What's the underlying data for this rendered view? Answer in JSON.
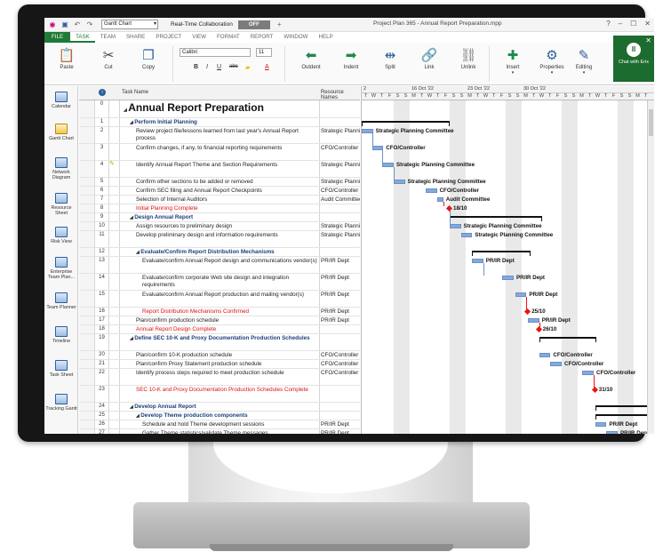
{
  "window": {
    "view_select": "Gantt Chart",
    "collab_label": "Real-Time Collaboration",
    "collab_toggle": "OFF",
    "title": "Project Plan 365 - Annual Report Preparation.mpp",
    "win_help": "?",
    "win_min": "–",
    "win_max": "☐",
    "win_close": "✕"
  },
  "tabs": [
    "FILE",
    "TASK",
    "TEAM",
    "SHARE",
    "PROJECT",
    "VIEW",
    "FORMAT",
    "REPORT",
    "WINDOW",
    "HELP"
  ],
  "ribbon": {
    "paste": "Paste",
    "cut": "Cut",
    "copy": "Copy",
    "font_name": "Calibri",
    "font_size": "11",
    "bold": "B",
    "italic": "I",
    "underline": "U",
    "strike": "abc",
    "outdent": "Outdent",
    "indent": "Indent",
    "split": "Split",
    "link": "Link",
    "unlink": "Unlink",
    "insert": "Insert",
    "properties": "Properties",
    "editing": "Editing",
    "chat": "Chat with Erix"
  },
  "leftnav": [
    "Calendar",
    "Gantt Chart",
    "Network Diagram",
    "Resource Sheet",
    "Risk View",
    "Enterprise Team Plan...",
    "Team Planner",
    "Timeline",
    "Task Sheet",
    "Tracking Gantt"
  ],
  "grid": {
    "header_task": "Task Name",
    "header_res": "Resource Names",
    "header_info": "i",
    "rows": [
      {
        "id": "0",
        "name": "Annual Report Preparation",
        "res": "",
        "type": "title",
        "indent": 0,
        "lines": 2
      },
      {
        "id": "1",
        "name": "Perform Initial Planning",
        "res": "",
        "type": "summary",
        "indent": 1,
        "lines": 1
      },
      {
        "id": "2",
        "name": "Review project file/lessons learned from last year's Annual Report process",
        "res": "Strategic Planning Commi",
        "type": "task",
        "indent": 2,
        "lines": 2
      },
      {
        "id": "3",
        "name": "Confirm changes, if any, to financial reporting requirements",
        "res": "CFO/Controller",
        "type": "task",
        "indent": 2,
        "lines": 2
      },
      {
        "id": "4",
        "name": "Identify Annual Report Theme and Section Requirements",
        "res": "Strategic Planning Commi",
        "type": "task",
        "indent": 2,
        "lines": 2
      },
      {
        "id": "5",
        "name": "Confirm other sections to be added or removed",
        "res": "Strategic Planning Commi",
        "type": "task",
        "indent": 2,
        "lines": 1
      },
      {
        "id": "6",
        "name": "Confirm SEC filing and Annual Report Checkpoints",
        "res": "CFO/Controller",
        "type": "task",
        "indent": 2,
        "lines": 1
      },
      {
        "id": "7",
        "name": "Selection of Internal Auditors",
        "res": "Audit Committee",
        "type": "task",
        "indent": 2,
        "lines": 1
      },
      {
        "id": "8",
        "name": "Initial Planning Complete",
        "res": "",
        "type": "milestone",
        "indent": 2,
        "lines": 1
      },
      {
        "id": "9",
        "name": "Design Annual Report",
        "res": "",
        "type": "summary",
        "indent": 1,
        "lines": 1
      },
      {
        "id": "10",
        "name": "Assign resources to preliminary design",
        "res": "Strategic Planning Commi",
        "type": "task",
        "indent": 2,
        "lines": 1
      },
      {
        "id": "11",
        "name": "Develop preliminary design and information requirements",
        "res": "Strategic Planning Commi",
        "type": "task",
        "indent": 2,
        "lines": 2
      },
      {
        "id": "12",
        "name": "Evaluate/Confirm Report Distribution Mechanisms",
        "res": "",
        "type": "summary",
        "indent": 2,
        "lines": 1
      },
      {
        "id": "13",
        "name": "Evaluate/confirm Annual Report design and communications vendor(s)",
        "res": "PR/IR Dept",
        "type": "task",
        "indent": 3,
        "lines": 2
      },
      {
        "id": "14",
        "name": "Evaluate/confirm corporate Web site design and integration requirements",
        "res": "PR/IR Dept",
        "type": "task",
        "indent": 3,
        "lines": 2
      },
      {
        "id": "15",
        "name": "Evaluate/confirm Annual Report production and mailing vendor(s)",
        "res": "PR/IR Dept",
        "type": "task",
        "indent": 3,
        "lines": 2
      },
      {
        "id": "16",
        "name": "Report Distribution Mechanisms Confirmed",
        "res": "PR/IR Dept",
        "type": "milestone",
        "indent": 3,
        "lines": 1
      },
      {
        "id": "17",
        "name": "Plan/confirm production schedule",
        "res": "PR/IR Dept",
        "type": "task",
        "indent": 2,
        "lines": 1
      },
      {
        "id": "18",
        "name": "Annual Report Design Complete",
        "res": "",
        "type": "milestone",
        "indent": 2,
        "lines": 1
      },
      {
        "id": "19",
        "name": "Define SEC 10-K and Proxy Documentation Production Schedules",
        "res": "",
        "type": "summary",
        "indent": 1,
        "lines": 2
      },
      {
        "id": "20",
        "name": "Plan/confirm 10-K production schedule",
        "res": "CFO/Controller",
        "type": "task",
        "indent": 2,
        "lines": 1
      },
      {
        "id": "21",
        "name": "Plan/confirm Proxy Statement production schedule",
        "res": "CFO/Controller",
        "type": "task",
        "indent": 2,
        "lines": 1
      },
      {
        "id": "22",
        "name": "Identify process steps required to meet production schedule",
        "res": "CFO/Controller",
        "type": "task",
        "indent": 2,
        "lines": 2
      },
      {
        "id": "23",
        "name": "SEC 10-K and Proxy Documentation Production Schedules Complete",
        "res": "",
        "type": "milestone",
        "indent": 2,
        "lines": 2
      },
      {
        "id": "24",
        "name": "Develop Annual Report",
        "res": "",
        "type": "summary",
        "indent": 1,
        "lines": 1
      },
      {
        "id": "25",
        "name": "Develop Theme production components",
        "res": "",
        "type": "summary",
        "indent": 2,
        "lines": 1
      },
      {
        "id": "26",
        "name": "Schedule and hold Theme development sessions",
        "res": "PR/IR Dept",
        "type": "task",
        "indent": 3,
        "lines": 1
      },
      {
        "id": "27",
        "name": "Gather Theme statistics/validate Theme messages",
        "res": "PR/IR Dept",
        "type": "task",
        "indent": 3,
        "lines": 1
      }
    ]
  },
  "gantt": {
    "week_labels": [
      "2",
      "16 Oct '22",
      "23 Oct '22",
      "30 Oct '22"
    ],
    "day_letters": [
      "T",
      "W",
      "T",
      "F",
      "S",
      "S",
      "M",
      "T",
      "W",
      "T",
      "F",
      "S",
      "S",
      "M",
      "T",
      "W",
      "T",
      "F",
      "S",
      "S",
      "M",
      "T",
      "W",
      "T",
      "F",
      "S",
      "S",
      "M",
      "T",
      "W",
      "T",
      "F",
      "S",
      "S",
      "M",
      "T"
    ],
    "labels": {
      "r2": "Strategic Planning Committee",
      "r3": "CFO/Controller",
      "r4": "Strategic Planning Committee",
      "r5": "Strategic Planning Committee",
      "r6": "CFO/Controller",
      "r7": "Audit Committee",
      "r8": "18/10",
      "r10": "Strategic Planning Committee",
      "r11": "Strategic Planning Committee",
      "r13": "PR/IR Dept",
      "r14": "PR/IR Dept",
      "r15": "PR/IR Dept",
      "r16": "25/10",
      "r17": "PR/IR Dept",
      "r18": "26/10",
      "r20": "CFO/Controller",
      "r21": "CFO/Controller",
      "r22": "CFO/Controller",
      "r23": "31/10",
      "r26": "PR/IR Dept",
      "r27": "PR/IR Dept"
    }
  }
}
